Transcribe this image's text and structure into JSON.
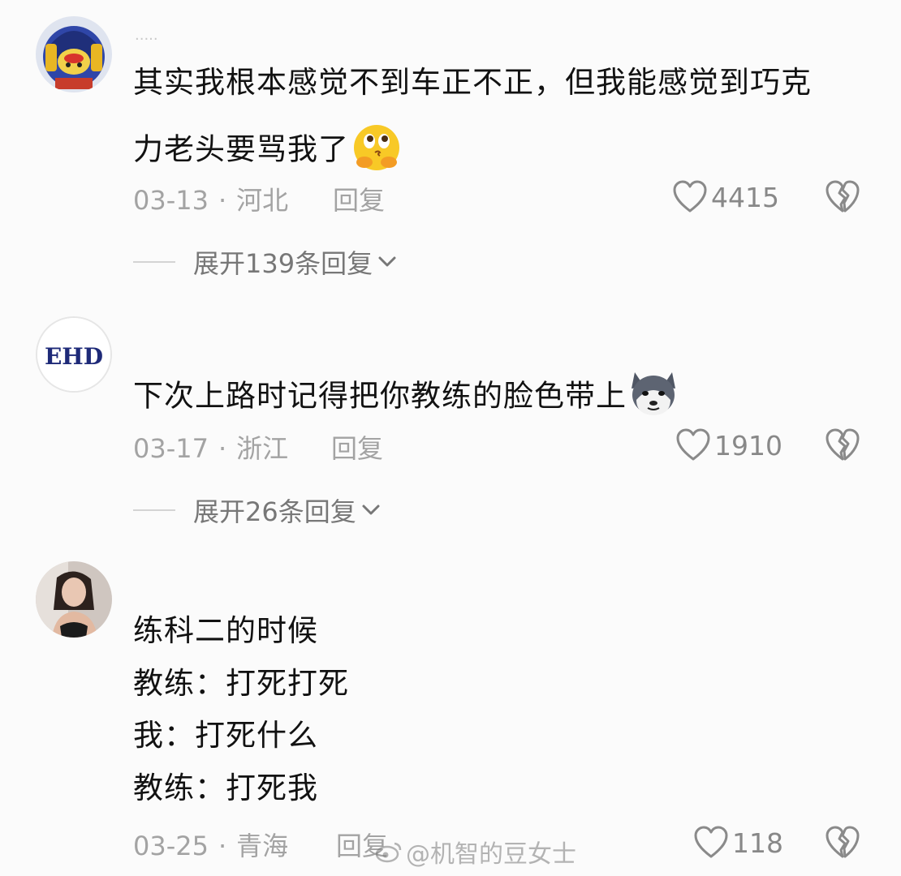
{
  "comments": [
    {
      "username": "·····",
      "lines": [
        "其实我根本感觉不到车正不正，但我能感觉到巧克",
        "力老头要骂我了"
      ],
      "emoji": "thinking-face-emoji",
      "date": "03-13",
      "location": "河北",
      "reply_label": "回复",
      "likes": "4415",
      "expand_label": "展开139条回复"
    },
    {
      "avatar_text": "EHD",
      "lines": [
        "下次上路时记得把你教练的脸色带上"
      ],
      "emoji": "husky-dog-emoji",
      "date": "03-17",
      "location": "浙江",
      "reply_label": "回复",
      "likes": "1910",
      "expand_label": "展开26条回复"
    },
    {
      "lines": [
        "练科二的时候",
        "教练：打死打死",
        "我：打死什么",
        "教练：打死我"
      ],
      "date": "03-25",
      "location": "青海",
      "reply_label": "回复",
      "likes": "118"
    }
  ],
  "watermark": "@机智的豆女士",
  "icons": {
    "like": "heart-outline-icon",
    "dislike": "broken-heart-icon",
    "expand": "chevron-down-icon"
  },
  "colors": {
    "text": "#121212",
    "meta": "#a3a3a3",
    "expand": "#777777",
    "background": "#fbfbfb"
  }
}
